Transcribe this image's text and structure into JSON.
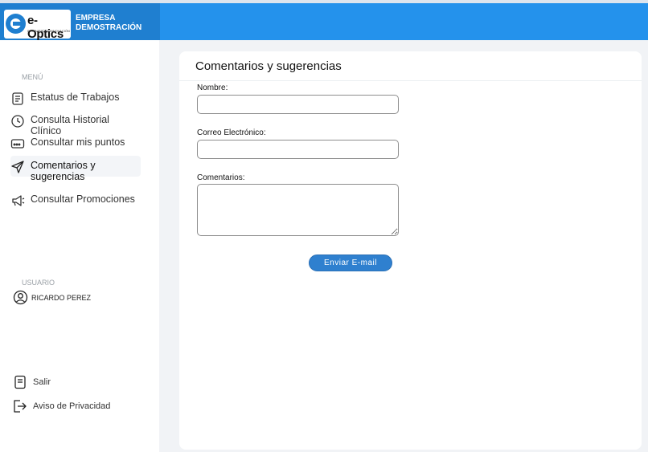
{
  "header": {
    "logo_name": "e-Optics",
    "logo_tagline": "INGENIERÍA & INNOVACIÓN",
    "company_line1": "EMPRESA",
    "company_line2": "DEMOSTRACIÓN",
    "accent_color": "#2492ec",
    "brand_color": "#1f7fd0"
  },
  "sidebar": {
    "menu_label": "MENÚ",
    "items": [
      {
        "label": "Estatus de Trabajos",
        "icon": "document-list-icon"
      },
      {
        "label": "Consulta Historial Clínico",
        "icon": "clock-icon"
      },
      {
        "label": "Consultar mis puntos",
        "icon": "card-icon"
      },
      {
        "label": "Comentarios y sugerencias",
        "icon": "send-icon",
        "active": true
      },
      {
        "label": "Consultar Promociones",
        "icon": "megaphone-icon"
      }
    ],
    "user_label": "USUARIO",
    "user_name": "RICARDO PEREZ",
    "logout_label": "Salir",
    "privacy_label": "Aviso de Privacidad"
  },
  "form": {
    "title": "Comentarios y sugerencias",
    "name_label": "Nombre:",
    "name_value": "",
    "email_label": "Correo Electrónico:",
    "email_value": "",
    "comments_label": "Comentarios:",
    "comments_value": "",
    "submit_label": "Enviar E-mail"
  }
}
